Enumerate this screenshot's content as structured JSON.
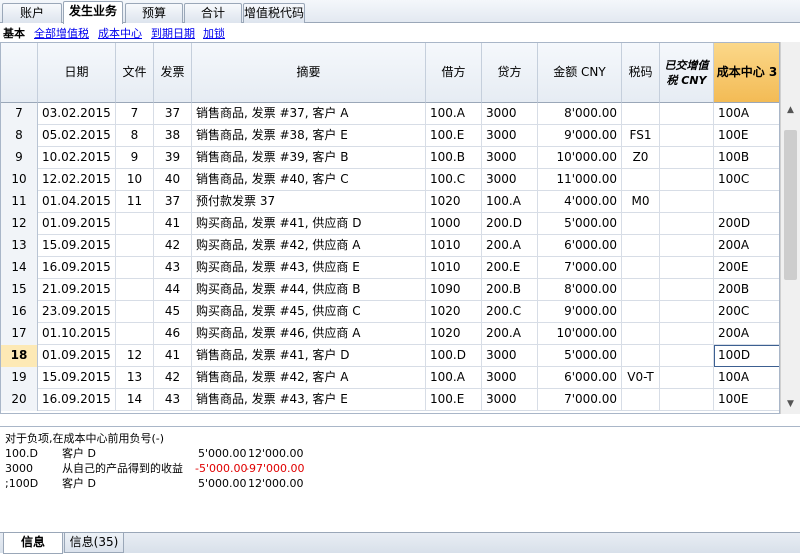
{
  "tabs": [
    {
      "label": "账户",
      "active": false
    },
    {
      "label": "发生业务",
      "active": true
    },
    {
      "label": "预算",
      "active": false
    },
    {
      "label": "合计",
      "active": false
    },
    {
      "label": "增值税代码",
      "active": false
    }
  ],
  "views": [
    {
      "label": "基本",
      "active": true
    },
    {
      "label": "全部增值税",
      "active": false
    },
    {
      "label": "成本中心",
      "active": false
    },
    {
      "label": "到期日期",
      "active": false
    },
    {
      "label": "加锁",
      "active": false
    }
  ],
  "columns": {
    "date": "日期",
    "doc": "文件",
    "invoice": "发票",
    "description": "摘要",
    "debit": "借方",
    "credit": "贷方",
    "amount": "金额 CNY",
    "vatcode": "税码",
    "vatposted": "已交增值税 CNY",
    "cc3": "成本中心 3"
  },
  "rows": [
    {
      "n": "7",
      "date": "03.02.2015",
      "doc": "7",
      "inv": "37",
      "desc": "销售商品, 发票 #37, 客户 A",
      "debit": "100.A",
      "credit": "3000",
      "amount": "8'000.00",
      "vat": "",
      "vatp": "",
      "cc3": "100A"
    },
    {
      "n": "8",
      "date": "05.02.2015",
      "doc": "8",
      "inv": "38",
      "desc": "销售商品, 发票 #38, 客户 E",
      "debit": "100.E",
      "credit": "3000",
      "amount": "9'000.00",
      "vat": "FS1",
      "vatp": "",
      "cc3": "100E"
    },
    {
      "n": "9",
      "date": "10.02.2015",
      "doc": "9",
      "inv": "39",
      "desc": "销售商品, 发票 #39, 客户 B",
      "debit": "100.B",
      "credit": "3000",
      "amount": "10'000.00",
      "vat": "Z0",
      "vatp": "",
      "cc3": "100B"
    },
    {
      "n": "10",
      "date": "12.02.2015",
      "doc": "10",
      "inv": "40",
      "desc": "销售商品, 发票 #40, 客户 C",
      "debit": "100.C",
      "credit": "3000",
      "amount": "11'000.00",
      "vat": "",
      "vatp": "",
      "cc3": "100C"
    },
    {
      "n": "11",
      "date": "01.04.2015",
      "doc": "11",
      "inv": "37",
      "desc": "预付款发票 37",
      "debit": "1020",
      "credit": "100.A",
      "amount": "4'000.00",
      "vat": "M0",
      "vatp": "",
      "cc3": ""
    },
    {
      "n": "12",
      "date": "01.09.2015",
      "doc": "",
      "inv": "41",
      "desc": "购买商品, 发票 #41, 供应商 D",
      "debit": "1000",
      "credit": "200.D",
      "amount": "5'000.00",
      "vat": "",
      "vatp": "",
      "cc3": "200D"
    },
    {
      "n": "13",
      "date": "15.09.2015",
      "doc": "",
      "inv": "42",
      "desc": "购买商品, 发票 #42, 供应商 A",
      "debit": "1010",
      "credit": "200.A",
      "amount": "6'000.00",
      "vat": "",
      "vatp": "",
      "cc3": "200A"
    },
    {
      "n": "14",
      "date": "16.09.2015",
      "doc": "",
      "inv": "43",
      "desc": "购买商品, 发票 #43, 供应商 E",
      "debit": "1010",
      "credit": "200.E",
      "amount": "7'000.00",
      "vat": "",
      "vatp": "",
      "cc3": "200E"
    },
    {
      "n": "15",
      "date": "21.09.2015",
      "doc": "",
      "inv": "44",
      "desc": "购买商品, 发票 #44, 供应商 B",
      "debit": "1090",
      "credit": "200.B",
      "amount": "8'000.00",
      "vat": "",
      "vatp": "",
      "cc3": "200B"
    },
    {
      "n": "16",
      "date": "23.09.2015",
      "doc": "",
      "inv": "45",
      "desc": "购买商品, 发票 #45, 供应商 C",
      "debit": "1020",
      "credit": "200.C",
      "amount": "9'000.00",
      "vat": "",
      "vatp": "",
      "cc3": "200C"
    },
    {
      "n": "17",
      "date": "01.10.2015",
      "doc": "",
      "inv": "46",
      "desc": "购买商品, 发票 #46, 供应商 A",
      "debit": "1020",
      "credit": "200.A",
      "amount": "10'000.00",
      "vat": "",
      "vatp": "",
      "cc3": "200A"
    },
    {
      "n": "18",
      "date": "01.09.2015",
      "doc": "12",
      "inv": "41",
      "desc": "销售商品, 发票 #41, 客户 D",
      "debit": "100.D",
      "credit": "3000",
      "amount": "5'000.00",
      "vat": "",
      "vatp": "",
      "cc3": "100D",
      "current": true
    },
    {
      "n": "19",
      "date": "15.09.2015",
      "doc": "13",
      "inv": "42",
      "desc": "销售商品, 发票 #42, 客户 A",
      "debit": "100.A",
      "credit": "3000",
      "amount": "6'000.00",
      "vat": "V0-T",
      "vatp": "",
      "cc3": "100A"
    },
    {
      "n": "20",
      "date": "16.09.2015",
      "doc": "14",
      "inv": "43",
      "desc": "销售商品, 发票 #43, 客户 E",
      "debit": "100.E",
      "credit": "3000",
      "amount": "7'000.00",
      "vat": "",
      "vatp": "",
      "cc3": "100E"
    }
  ],
  "info": {
    "hint": "对于负项,在成本中心前用负号(-)",
    "lines": [
      {
        "account": "100.D",
        "label": "客户 D",
        "a": "5'000.00",
        "b": "12'000.00",
        "negative": false
      },
      {
        "account": "3000",
        "label": "从自己的产品得到的收益",
        "a": "-5'000.00",
        "b": "-97'000.00",
        "negative": true
      },
      {
        "account": ";100D",
        "label": "客户 D",
        "a": "5'000.00",
        "b": "12'000.00",
        "negative": false
      }
    ]
  },
  "bottom_tabs": [
    {
      "label": "信息",
      "active": true
    },
    {
      "label": "信息(35)",
      "active": false
    }
  ],
  "colors": {
    "header_cc": "#f3bb55",
    "negative": "#e00000",
    "link": "#0000ee"
  }
}
